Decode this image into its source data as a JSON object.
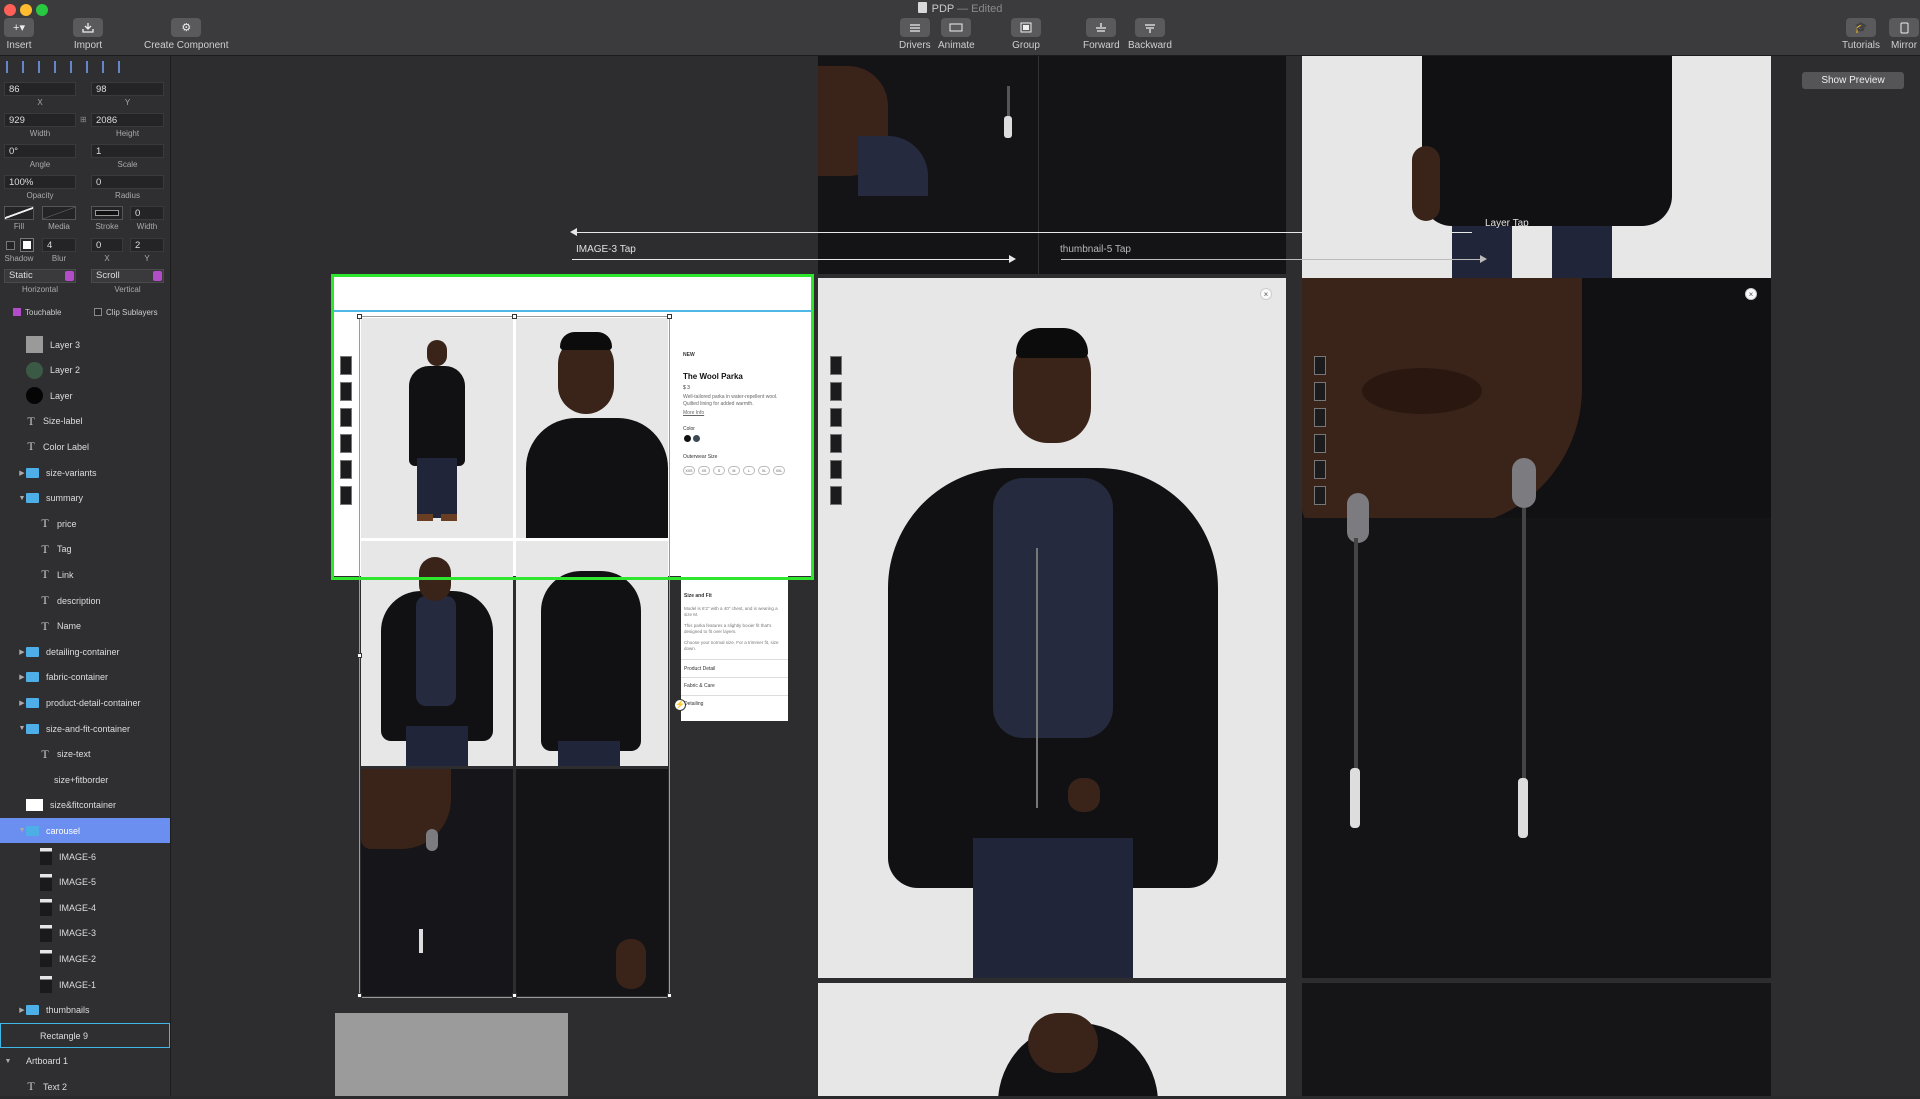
{
  "window": {
    "title": "PDP",
    "status": "— Edited",
    "traffic_colors": [
      "#fe5f57",
      "#febc2e",
      "#28c840"
    ]
  },
  "toolbar": {
    "insert": "Insert",
    "import": "Import",
    "create_component": "Create Component",
    "drivers": "Drivers",
    "animate": "Animate",
    "group": "Group",
    "forward": "Forward",
    "backward": "Backward",
    "tutorials": "Tutorials",
    "mirror": "Mirror"
  },
  "inspector": {
    "x": "86",
    "y": "98",
    "x_label": "X",
    "y_label": "Y",
    "width": "929",
    "height": "2086",
    "width_label": "Width",
    "height_label": "Height",
    "angle": "0°",
    "scale": "1",
    "angle_label": "Angle",
    "scale_label": "Scale",
    "opacity": "100%",
    "radius": "0",
    "opacity_label": "Opacity",
    "radius_label": "Radius",
    "fill_label": "Fill",
    "media_label": "Media",
    "stroke_label": "Stroke",
    "stroke_width": "0",
    "stroke_width_label": "Width",
    "shadow_label": "Shadow",
    "blur": "4",
    "blur_label": "Blur",
    "shadow_x": "0",
    "shadow_y": "2",
    "shadow_x_label": "X",
    "shadow_y_label": "Y",
    "horizontal": "Static",
    "vertical": "Scroll",
    "horizontal_label": "Horizontal",
    "vertical_label": "Vertical",
    "touchable": "Touchable",
    "clip_sublayers": "Clip Sublayers"
  },
  "layers": [
    {
      "name": "Layer 3",
      "icon": "box",
      "indent": 1,
      "tri": ""
    },
    {
      "name": "Layer 2",
      "icon": "circ-g",
      "indent": 1,
      "tri": ""
    },
    {
      "name": "Layer",
      "icon": "circ-b",
      "indent": 1,
      "tri": ""
    },
    {
      "name": "Size-label",
      "icon": "T",
      "indent": 1,
      "tri": ""
    },
    {
      "name": "Color Label",
      "icon": "T",
      "indent": 1,
      "tri": ""
    },
    {
      "name": "size-variants",
      "icon": "folder",
      "indent": 1,
      "tri": "▶"
    },
    {
      "name": "summary",
      "icon": "folder",
      "indent": 1,
      "tri": "▼"
    },
    {
      "name": "price",
      "icon": "T",
      "indent": 2,
      "tri": ""
    },
    {
      "name": "Tag",
      "icon": "T",
      "indent": 2,
      "tri": ""
    },
    {
      "name": "Link",
      "icon": "T",
      "indent": 2,
      "tri": ""
    },
    {
      "name": "description",
      "icon": "T",
      "indent": 2,
      "tri": ""
    },
    {
      "name": "Name",
      "icon": "T",
      "indent": 2,
      "tri": ""
    },
    {
      "name": "detailing-container",
      "icon": "folder",
      "indent": 1,
      "tri": "▶"
    },
    {
      "name": "fabric-container",
      "icon": "folder",
      "indent": 1,
      "tri": "▶"
    },
    {
      "name": "product-detail-container",
      "icon": "folder",
      "indent": 1,
      "tri": "▶"
    },
    {
      "name": "size-and-fit-container",
      "icon": "folder",
      "indent": 1,
      "tri": "▼"
    },
    {
      "name": "size-text",
      "icon": "T",
      "indent": 2,
      "tri": ""
    },
    {
      "name": "size+fitborder",
      "icon": "",
      "indent": 2,
      "tri": ""
    },
    {
      "name": "size&fitcontainer",
      "icon": "rect-w",
      "indent": 1,
      "tri": ""
    },
    {
      "name": "carousel",
      "icon": "folder",
      "indent": 1,
      "tri": "▼",
      "state": "selected"
    },
    {
      "name": "IMAGE-6",
      "icon": "img",
      "indent": 2,
      "tri": ""
    },
    {
      "name": "IMAGE-5",
      "icon": "img",
      "indent": 2,
      "tri": ""
    },
    {
      "name": "IMAGE-4",
      "icon": "img",
      "indent": 2,
      "tri": ""
    },
    {
      "name": "IMAGE-3",
      "icon": "img",
      "indent": 2,
      "tri": ""
    },
    {
      "name": "IMAGE-2",
      "icon": "img",
      "indent": 2,
      "tri": ""
    },
    {
      "name": "IMAGE-1",
      "icon": "img",
      "indent": 2,
      "tri": ""
    },
    {
      "name": "thumbnails",
      "icon": "folder",
      "indent": 1,
      "tri": "▶"
    },
    {
      "name": "Rectangle 9",
      "icon": "",
      "indent": 1,
      "tri": "",
      "state": "outlined"
    },
    {
      "name": "Artboard 1",
      "icon": "",
      "indent": 0,
      "tri": "▼"
    },
    {
      "name": "Text 2",
      "icon": "T",
      "indent": 1,
      "tri": ""
    }
  ],
  "canvas": {
    "show_preview": "Show Preview",
    "layer_tap": "Layer Tap",
    "image3_tap": "IMAGE-3 Tap",
    "thumbnail5_tap": "thumbnail-5 Tap",
    "selection_color": "#2ee62e",
    "close_glyph": "×",
    "pdp": {
      "tag": "NEW",
      "name": "The Wool Parka",
      "price": "$ 3",
      "desc_line1": "Well-tailored parka in water-repellent wool.",
      "desc_line2": "Quilted lining for added warmth.",
      "link": "More Info",
      "color_label": "Color",
      "size_label": "Outerwear Size",
      "sizes": [
        "XXS",
        "XS",
        "S",
        "M",
        "L",
        "XL",
        "XXL"
      ],
      "size_fit_title": "Size and Fit",
      "fit_line1": "Model is 6'2\" with a 40\" chest, and is wearing a",
      "fit_line2": "size M.",
      "fit_line3": "This parka features a slightly boxier fit that's",
      "fit_line4": "designed to fit over layers.",
      "fit_line5": "Choose your normal size. For a trimmer fit, size",
      "fit_line6": "down.",
      "sections": [
        "Product Detail",
        "Fabric & Care",
        "Detailing"
      ]
    }
  }
}
